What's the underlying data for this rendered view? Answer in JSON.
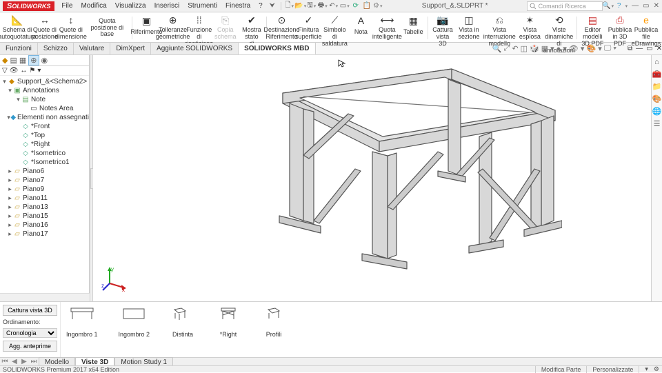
{
  "app": {
    "brand_prefix": "S",
    "brand_rest": "OLIDWORKS",
    "doc_title": "Support_&.SLDPRT *"
  },
  "menu": [
    "File",
    "Modifica",
    "Visualizza",
    "Inserisci",
    "Strumenti",
    "Finestra",
    "?"
  ],
  "search_placeholder": "Comandi Ricerca",
  "ribbon": [
    {
      "label": "Schema di\nautoquotatura"
    },
    {
      "label": "Quote di\nposizione"
    },
    {
      "label": "Quote di\ndimensione"
    },
    {
      "label": "Quota posizione di base"
    },
    {
      "label": "Riferimento"
    },
    {
      "label": "Tolleranze\ngeometriche"
    },
    {
      "label": "Funzione di\nripetizione"
    },
    {
      "label": "Copia\nschema",
      "dim": true
    },
    {
      "label": "Mostra stato\ndi tolleranza"
    },
    {
      "label": "Destinazione\nRiferimento"
    },
    {
      "label": "Finitura\nsuperficie"
    },
    {
      "label": "Simbolo di\nsaldatura"
    },
    {
      "label": "Nota"
    },
    {
      "label": "Quota\nintelligente"
    },
    {
      "label": "Tabelle"
    },
    {
      "label": "Cattura\nvista 3D"
    },
    {
      "label": "Vista in\nsezione"
    },
    {
      "label": "Vista interruzione\nmodello"
    },
    {
      "label": "Vista\nesplosa"
    },
    {
      "label": "Viste dinamiche\ndi annotazioni"
    },
    {
      "label": "Editor modelli\n3D PDF"
    },
    {
      "label": "Pubblica\nin 3D PDF"
    },
    {
      "label": "Pubblica file\neDrawings"
    }
  ],
  "ribbon_tabs": [
    "Funzioni",
    "Schizzo",
    "Valutare",
    "DimXpert",
    "Aggiunte SOLIDWORKS",
    "SOLIDWORKS MBD"
  ],
  "tree": {
    "root": "Support_&<Schema2>",
    "annotations": "Annotations",
    "note": "Note",
    "notes_area": "Notes Area",
    "unassigned": "Elementi non assegnati",
    "front": "*Front",
    "top": "*Top",
    "right": "*Right",
    "iso": "*Isometrico",
    "iso1": "*Isometrico1",
    "planes": [
      "Piano6",
      "Piano7",
      "Piano9",
      "Piano11",
      "Piano13",
      "Piano15",
      "Piano16",
      "Piano17"
    ]
  },
  "views_panel": {
    "capture": "Cattura vista 3D",
    "sort_label": "Ordinamento:",
    "sort_value": "Cronologia",
    "update": "Agg. anteprime",
    "thumbs": [
      "Ingombro 1",
      "Ingombro 2",
      "Distinta",
      "*Right",
      "Profili"
    ]
  },
  "bottom_tabs": [
    "Modello",
    "Viste 3D",
    "Motion Study 1"
  ],
  "status": {
    "edition": "SOLIDWORKS Premium 2017 x64 Edition",
    "mode": "Modifica Parte",
    "custom": "Personalizzate"
  },
  "triad": {
    "x": "x",
    "y": "y",
    "z": "z"
  }
}
